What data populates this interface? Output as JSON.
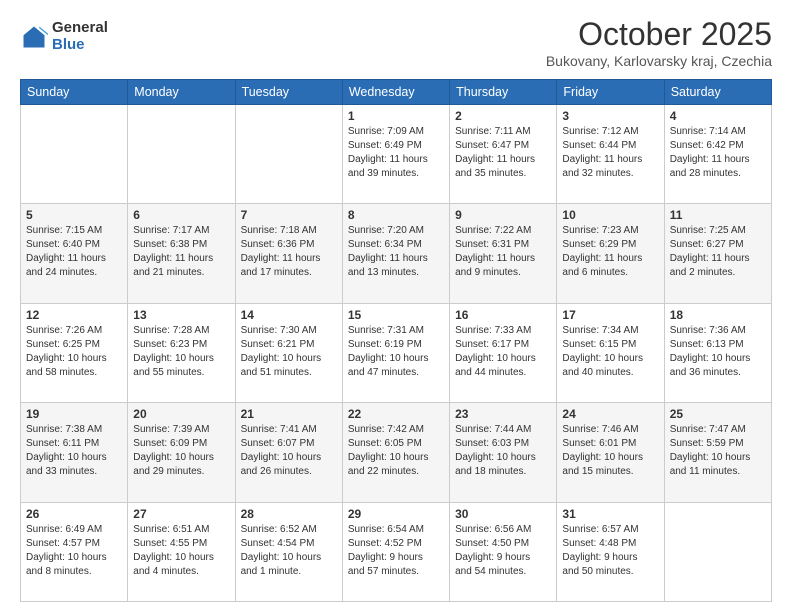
{
  "header": {
    "logo_general": "General",
    "logo_blue": "Blue",
    "month_title": "October 2025",
    "location": "Bukovany, Karlovarsky kraj, Czechia"
  },
  "weekdays": [
    "Sunday",
    "Monday",
    "Tuesday",
    "Wednesday",
    "Thursday",
    "Friday",
    "Saturday"
  ],
  "weeks": [
    [
      {
        "day": "",
        "details": ""
      },
      {
        "day": "",
        "details": ""
      },
      {
        "day": "",
        "details": ""
      },
      {
        "day": "1",
        "details": "Sunrise: 7:09 AM\nSunset: 6:49 PM\nDaylight: 11 hours\nand 39 minutes."
      },
      {
        "day": "2",
        "details": "Sunrise: 7:11 AM\nSunset: 6:47 PM\nDaylight: 11 hours\nand 35 minutes."
      },
      {
        "day": "3",
        "details": "Sunrise: 7:12 AM\nSunset: 6:44 PM\nDaylight: 11 hours\nand 32 minutes."
      },
      {
        "day": "4",
        "details": "Sunrise: 7:14 AM\nSunset: 6:42 PM\nDaylight: 11 hours\nand 28 minutes."
      }
    ],
    [
      {
        "day": "5",
        "details": "Sunrise: 7:15 AM\nSunset: 6:40 PM\nDaylight: 11 hours\nand 24 minutes."
      },
      {
        "day": "6",
        "details": "Sunrise: 7:17 AM\nSunset: 6:38 PM\nDaylight: 11 hours\nand 21 minutes."
      },
      {
        "day": "7",
        "details": "Sunrise: 7:18 AM\nSunset: 6:36 PM\nDaylight: 11 hours\nand 17 minutes."
      },
      {
        "day": "8",
        "details": "Sunrise: 7:20 AM\nSunset: 6:34 PM\nDaylight: 11 hours\nand 13 minutes."
      },
      {
        "day": "9",
        "details": "Sunrise: 7:22 AM\nSunset: 6:31 PM\nDaylight: 11 hours\nand 9 minutes."
      },
      {
        "day": "10",
        "details": "Sunrise: 7:23 AM\nSunset: 6:29 PM\nDaylight: 11 hours\nand 6 minutes."
      },
      {
        "day": "11",
        "details": "Sunrise: 7:25 AM\nSunset: 6:27 PM\nDaylight: 11 hours\nand 2 minutes."
      }
    ],
    [
      {
        "day": "12",
        "details": "Sunrise: 7:26 AM\nSunset: 6:25 PM\nDaylight: 10 hours\nand 58 minutes."
      },
      {
        "day": "13",
        "details": "Sunrise: 7:28 AM\nSunset: 6:23 PM\nDaylight: 10 hours\nand 55 minutes."
      },
      {
        "day": "14",
        "details": "Sunrise: 7:30 AM\nSunset: 6:21 PM\nDaylight: 10 hours\nand 51 minutes."
      },
      {
        "day": "15",
        "details": "Sunrise: 7:31 AM\nSunset: 6:19 PM\nDaylight: 10 hours\nand 47 minutes."
      },
      {
        "day": "16",
        "details": "Sunrise: 7:33 AM\nSunset: 6:17 PM\nDaylight: 10 hours\nand 44 minutes."
      },
      {
        "day": "17",
        "details": "Sunrise: 7:34 AM\nSunset: 6:15 PM\nDaylight: 10 hours\nand 40 minutes."
      },
      {
        "day": "18",
        "details": "Sunrise: 7:36 AM\nSunset: 6:13 PM\nDaylight: 10 hours\nand 36 minutes."
      }
    ],
    [
      {
        "day": "19",
        "details": "Sunrise: 7:38 AM\nSunset: 6:11 PM\nDaylight: 10 hours\nand 33 minutes."
      },
      {
        "day": "20",
        "details": "Sunrise: 7:39 AM\nSunset: 6:09 PM\nDaylight: 10 hours\nand 29 minutes."
      },
      {
        "day": "21",
        "details": "Sunrise: 7:41 AM\nSunset: 6:07 PM\nDaylight: 10 hours\nand 26 minutes."
      },
      {
        "day": "22",
        "details": "Sunrise: 7:42 AM\nSunset: 6:05 PM\nDaylight: 10 hours\nand 22 minutes."
      },
      {
        "day": "23",
        "details": "Sunrise: 7:44 AM\nSunset: 6:03 PM\nDaylight: 10 hours\nand 18 minutes."
      },
      {
        "day": "24",
        "details": "Sunrise: 7:46 AM\nSunset: 6:01 PM\nDaylight: 10 hours\nand 15 minutes."
      },
      {
        "day": "25",
        "details": "Sunrise: 7:47 AM\nSunset: 5:59 PM\nDaylight: 10 hours\nand 11 minutes."
      }
    ],
    [
      {
        "day": "26",
        "details": "Sunrise: 6:49 AM\nSunset: 4:57 PM\nDaylight: 10 hours\nand 8 minutes."
      },
      {
        "day": "27",
        "details": "Sunrise: 6:51 AM\nSunset: 4:55 PM\nDaylight: 10 hours\nand 4 minutes."
      },
      {
        "day": "28",
        "details": "Sunrise: 6:52 AM\nSunset: 4:54 PM\nDaylight: 10 hours\nand 1 minute."
      },
      {
        "day": "29",
        "details": "Sunrise: 6:54 AM\nSunset: 4:52 PM\nDaylight: 9 hours\nand 57 minutes."
      },
      {
        "day": "30",
        "details": "Sunrise: 6:56 AM\nSunset: 4:50 PM\nDaylight: 9 hours\nand 54 minutes."
      },
      {
        "day": "31",
        "details": "Sunrise: 6:57 AM\nSunset: 4:48 PM\nDaylight: 9 hours\nand 50 minutes."
      },
      {
        "day": "",
        "details": ""
      }
    ]
  ]
}
